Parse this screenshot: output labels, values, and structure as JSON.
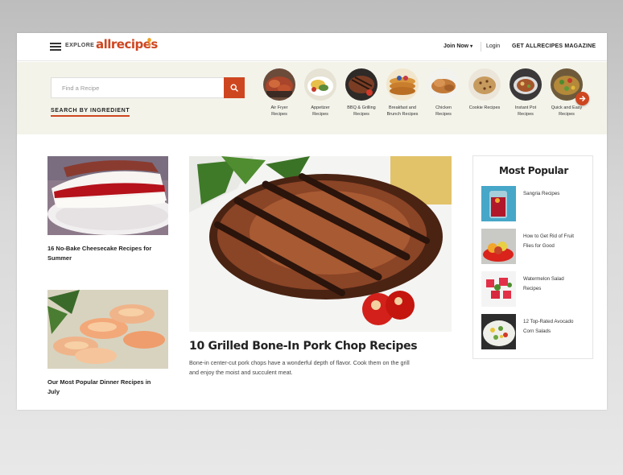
{
  "header": {
    "explore_label": "EXPLORE",
    "logo_text": "allrecipes",
    "join_label": "Join Now",
    "login_label": "Login",
    "magazine_label": "GET ALLRECIPES MAGAZINE"
  },
  "search": {
    "placeholder": "Find a Recipe",
    "by_ingredient_label": "SEARCH BY INGREDIENT"
  },
  "categories": [
    {
      "line1": "Air Fryer",
      "line2": "Recipes"
    },
    {
      "line1": "Appetizer",
      "line2": "Recipes"
    },
    {
      "line1": "BBQ & Grilling",
      "line2": "Recipes"
    },
    {
      "line1": "Breakfast and",
      "line2": "Brunch Recipes"
    },
    {
      "line1": "Chicken",
      "line2": "Recipes"
    },
    {
      "line1": "Cookie Recipes",
      "line2": ""
    },
    {
      "line1": "Instant Pot",
      "line2": "Recipes"
    },
    {
      "line1": "Quick and Easy",
      "line2": "Recipes"
    }
  ],
  "cards": [
    {
      "title_line1": "16 No-Bake Cheesecake Recipes for",
      "title_line2": "Summer"
    },
    {
      "title_line1": "Our Most Popular Dinner Recipes in",
      "title_line2": "July"
    }
  ],
  "feature": {
    "title": "10 Grilled Bone-In Pork Chop Recipes",
    "desc_line1": "Bone-in center-cut pork chops have a wonderful depth of flavor. Cook them on the grill",
    "desc_line2": "and enjoy the moist and succulent meat."
  },
  "popular": {
    "title": "Most Popular",
    "items": [
      {
        "line1": "Sangria Recipes",
        "line2": ""
      },
      {
        "line1": "How to Get Rid of Fruit",
        "line2": "Flies for Good"
      },
      {
        "line1": "Watermelon Salad",
        "line2": "Recipes"
      },
      {
        "line1": "12 Top-Rated Avocado",
        "line2": "Corn Salads"
      }
    ]
  },
  "colors": {
    "brand": "#ce4620",
    "band": "#f3f3ea"
  }
}
